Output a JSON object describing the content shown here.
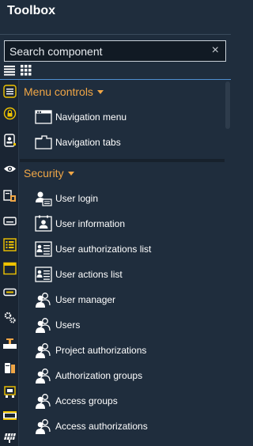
{
  "panel": {
    "title": "Toolbox"
  },
  "search": {
    "placeholder": "Search component",
    "clear_glyph": "×"
  },
  "view_modes": [
    {
      "name": "list-view-icon"
    },
    {
      "name": "grid-view-icon"
    }
  ],
  "icon_strip": [
    "list-icon",
    "lock-icon",
    "id-card-icon",
    "eye-icon",
    "book-icon",
    "keyboard-icon",
    "menu-list-icon",
    "window-icon",
    "tag-icon",
    "gears-icon",
    "valve-icon",
    "cylinder-icon",
    "machine-icon",
    "film-icon",
    "solar-panel-icon"
  ],
  "groups": [
    {
      "label": "Menu controls",
      "items": [
        {
          "label": "Navigation menu",
          "icon": "window-icon"
        },
        {
          "label": "Navigation tabs",
          "icon": "tabs-icon"
        }
      ]
    },
    {
      "label": "Security",
      "items": [
        {
          "label": "User login",
          "icon": "user-login-icon"
        },
        {
          "label": "User information",
          "icon": "user-card-icon"
        },
        {
          "label": "User authorizations list",
          "icon": "user-list-icon"
        },
        {
          "label": "User actions list",
          "icon": "user-list-icon"
        },
        {
          "label": "User manager",
          "icon": "users-icon"
        },
        {
          "label": "Users",
          "icon": "users-icon"
        },
        {
          "label": "Project authorizations",
          "icon": "users-icon"
        },
        {
          "label": "Authorization groups",
          "icon": "users-icon"
        },
        {
          "label": "Access groups",
          "icon": "users-icon"
        },
        {
          "label": "Access authorizations",
          "icon": "users-icon"
        }
      ]
    }
  ],
  "colors": {
    "background": "#1f2d3d",
    "accent": "#f0a646",
    "text": "#ffffff",
    "divider": "#4f8fd0"
  }
}
